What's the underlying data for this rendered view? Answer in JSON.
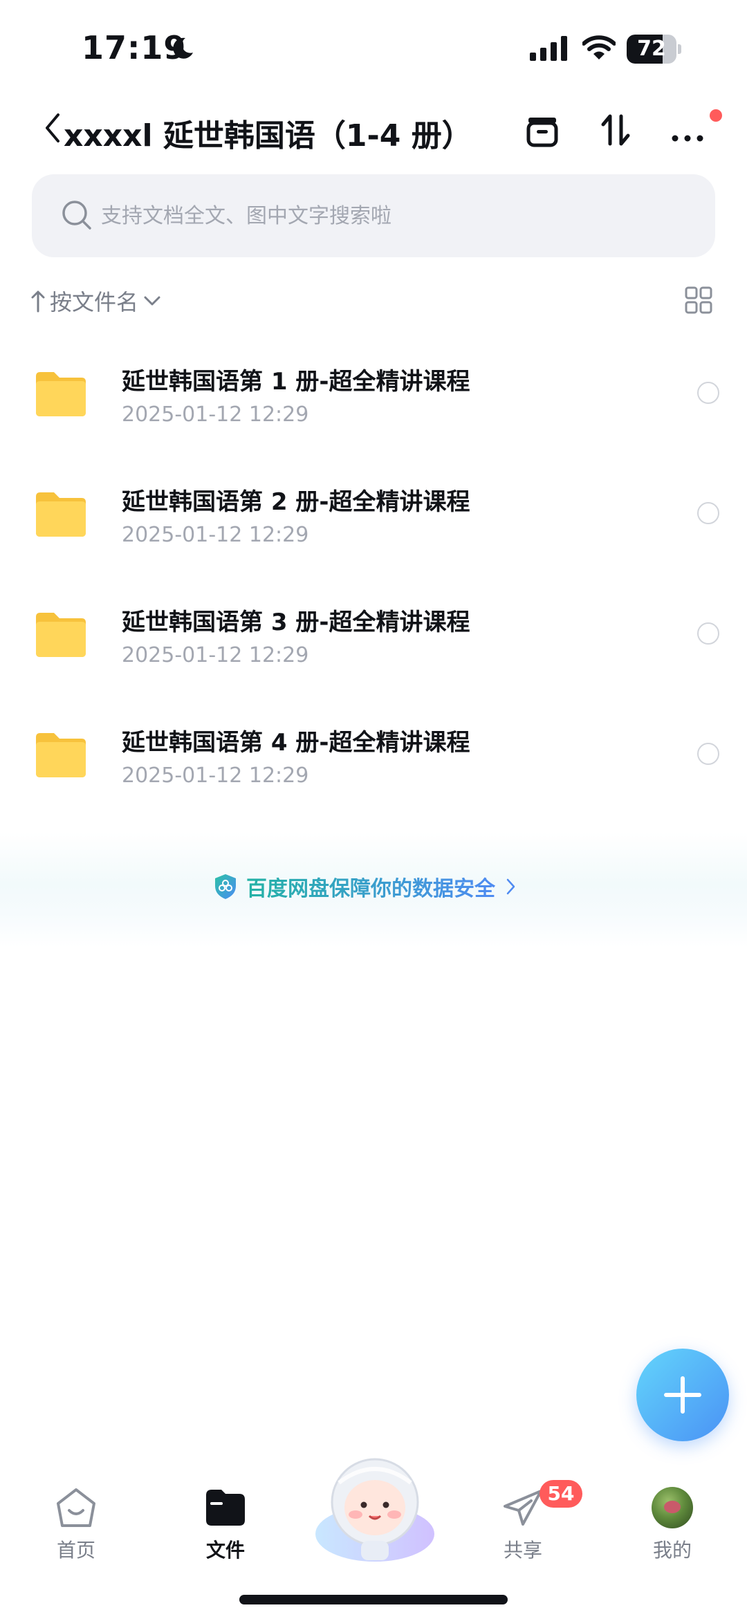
{
  "status_bar": {
    "time": "17:19",
    "battery_level": "72",
    "battery_fraction": 0.72,
    "icons": [
      "moon-icon",
      "signal-icon",
      "wifi-icon",
      "battery-icon"
    ]
  },
  "header": {
    "title": "xxxxl 延世韩国语（1-4 册）",
    "icons": [
      "back-chevron-icon",
      "box-icon",
      "sort-arrows-icon",
      "more-icon"
    ],
    "notification_dot_color": "#ff5b5b"
  },
  "search": {
    "placeholder": "支持文档全文、图中文字搜索啦"
  },
  "sort": {
    "label": "按文件名"
  },
  "files": [
    {
      "name": "延世韩国语第 1 册-超全精讲课程",
      "date": "2025-01-12 12:29"
    },
    {
      "name": "延世韩国语第 2 册-超全精讲课程",
      "date": "2025-01-12 12:29"
    },
    {
      "name": "延世韩国语第 3 册-超全精讲课程",
      "date": "2025-01-12 12:29"
    },
    {
      "name": "延世韩国语第 4 册-超全精讲课程",
      "date": "2025-01-12 12:29"
    }
  ],
  "security_banner": {
    "text": "百度网盘保障你的数据安全"
  },
  "bottom_nav": {
    "items": [
      {
        "label": "首页",
        "icon": "home-icon"
      },
      {
        "label": "文件",
        "icon": "folder-icon",
        "active": true
      },
      {
        "label": "共享",
        "icon": "paper-plane-icon",
        "badge": "54"
      },
      {
        "label": "我的",
        "icon": "avatar"
      }
    ]
  },
  "colors": {
    "accent": "#4a92f5",
    "folder": "#ffd24d",
    "badge": "#ff5b5b"
  }
}
